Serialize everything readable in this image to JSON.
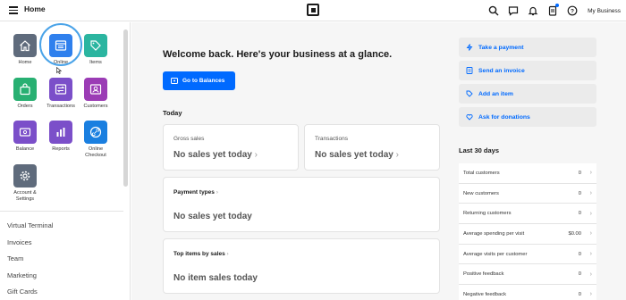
{
  "header": {
    "title": "Home",
    "business": "My Business"
  },
  "sidebar": {
    "tiles": [
      {
        "label": "Home",
        "icon": "home-icon",
        "color": "#5f6b7c"
      },
      {
        "label": "Online",
        "icon": "online-store-icon",
        "color": "#2f80ed"
      },
      {
        "label": "Items",
        "icon": "tag-icon",
        "color": "#2bb5a0"
      },
      {
        "label": "Orders",
        "icon": "shopping-bag-icon",
        "color": "#28b072"
      },
      {
        "label": "Transactions",
        "icon": "transactions-icon",
        "color": "#7b4fc9"
      },
      {
        "label": "Customers",
        "icon": "customers-icon",
        "color": "#9b3cb5"
      },
      {
        "label": "Balance",
        "icon": "balance-icon",
        "color": "#7b4fc9"
      },
      {
        "label": "Reports",
        "icon": "reports-icon",
        "color": "#7b4fc9"
      },
      {
        "label": "Online Checkout",
        "icon": "link-icon",
        "color": "#1a7fe0"
      },
      {
        "label": "Account & Settings",
        "icon": "gear-icon",
        "color": "#5f6b7c"
      }
    ],
    "nav": [
      "Virtual Terminal",
      "Invoices",
      "Team",
      "Marketing",
      "Gift Cards"
    ]
  },
  "main": {
    "welcome": "Welcome back. Here's your business at a glance.",
    "balances_button": "Go to Balances",
    "today_label": "Today",
    "gross_sales": {
      "title": "Gross sales",
      "value": "No sales yet today"
    },
    "transactions": {
      "title": "Transactions",
      "value": "No sales yet today"
    },
    "payment_types": {
      "title": "Payment types",
      "value": "No sales yet today"
    },
    "top_items": {
      "title": "Top items by sales",
      "value": "No item sales today"
    }
  },
  "actions": [
    {
      "label": "Take a payment",
      "icon": "lightning-icon"
    },
    {
      "label": "Send an invoice",
      "icon": "invoice-icon"
    },
    {
      "label": "Add an item",
      "icon": "tag-icon"
    },
    {
      "label": "Ask for donations",
      "icon": "heart-icon"
    }
  ],
  "last30": {
    "title": "Last 30 days",
    "rows": [
      {
        "label": "Total customers",
        "value": "0"
      },
      {
        "label": "New customers",
        "value": "0"
      },
      {
        "label": "Returning customers",
        "value": "0"
      },
      {
        "label": "Average spending per visit",
        "value": "$0.00"
      },
      {
        "label": "Average visits per customer",
        "value": "0"
      },
      {
        "label": "Positive feedback",
        "value": "0"
      },
      {
        "label": "Negative feedback",
        "value": "0"
      }
    ]
  },
  "colors": {
    "accent": "#006aff",
    "highlight_ring": "#4aa3e8"
  }
}
